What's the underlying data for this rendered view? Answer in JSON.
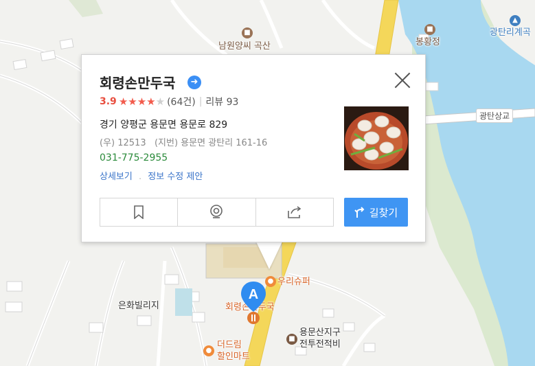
{
  "map": {
    "pois": [
      {
        "name": "남원양씨 곡산",
        "kind": "brown"
      },
      {
        "name": "봉황정",
        "kind": "brown"
      },
      {
        "name": "광탄리계곡",
        "kind": "blue"
      },
      {
        "name": "광탄상교",
        "kind": "road"
      },
      {
        "name": "우리슈퍼",
        "kind": "orange"
      },
      {
        "name": "은화빌리지",
        "kind": "dark"
      },
      {
        "name": "회령손만두국",
        "kind": "orange"
      },
      {
        "name": "용문산지구",
        "kind": "dark"
      },
      {
        "name": "전투전적비",
        "kind": "dark"
      },
      {
        "name": "더드림",
        "kind": "orange"
      },
      {
        "name": "할인마트",
        "kind": "orange"
      }
    ],
    "marker_letter": "A"
  },
  "place": {
    "name": "회령손만두국",
    "rating": "3.9",
    "stars": 4,
    "rating_count": "(64건)",
    "review_label": "리뷰 93",
    "address": "경기 양평군 용문면 용문로 829",
    "address_detail": "(우) 12513   (지번) 용문면 광탄리 161-16",
    "phone": "031-775-2955",
    "detail_link": "상세보기",
    "edit_link": "정보 수정 제안",
    "route_label": "길찾기"
  },
  "icons": {
    "save": "bookmark-icon",
    "roadview": "roadview-icon",
    "share": "share-icon",
    "route": "route-icon",
    "close": "close-icon",
    "verified": "arrow-right-icon"
  },
  "colors": {
    "accent": "#3f95f3",
    "rating": "#e84e3f",
    "phone": "#2a8a3a",
    "link": "#3a74c9",
    "river": "#a8d8f0",
    "road": "#f4d75a"
  }
}
